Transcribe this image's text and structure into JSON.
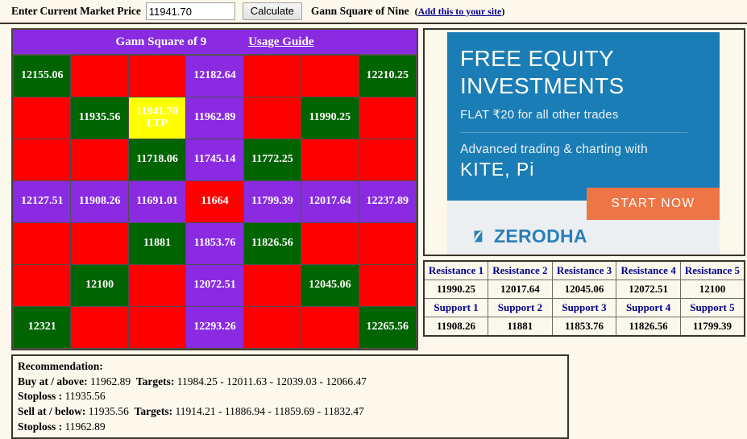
{
  "topbar": {
    "label": "Enter Current Market Price",
    "input_value": "11941.70",
    "input_placeholder": "",
    "calculate_label": "Calculate",
    "title": "Gann Square of Nine",
    "link_open": "(",
    "link_text": "Add this to your site",
    "link_close": ")"
  },
  "gann": {
    "header_title": "Gann Square of 9",
    "header_link": "Usage Guide",
    "colors": {
      "red": "#fe0000",
      "green": "#006400",
      "purple": "#8a2be2",
      "yellow": "#ffff00",
      "ltp_text": "#fe0000"
    },
    "ltp_label": "LTP",
    "rows": [
      [
        {
          "text": "12155.06",
          "color": "green"
        },
        {
          "text": "",
          "color": "red"
        },
        {
          "text": "",
          "color": "red"
        },
        {
          "text": "12182.64",
          "color": "purple"
        },
        {
          "text": "",
          "color": "red"
        },
        {
          "text": "",
          "color": "red"
        },
        {
          "text": "12210.25",
          "color": "green"
        }
      ],
      [
        {
          "text": "",
          "color": "red"
        },
        {
          "text": "11935.56",
          "color": "green"
        },
        {
          "text": "11941.70",
          "color": "yellow",
          "ltp": true
        },
        {
          "text": "11962.89",
          "color": "purple"
        },
        {
          "text": "",
          "color": "red"
        },
        {
          "text": "11990.25",
          "color": "green"
        },
        {
          "text": "",
          "color": "red"
        }
      ],
      [
        {
          "text": "",
          "color": "red"
        },
        {
          "text": "",
          "color": "red"
        },
        {
          "text": "11718.06",
          "color": "green"
        },
        {
          "text": "11745.14",
          "color": "purple"
        },
        {
          "text": "11772.25",
          "color": "green"
        },
        {
          "text": "",
          "color": "red"
        },
        {
          "text": "",
          "color": "red"
        }
      ],
      [
        {
          "text": "12127.51",
          "color": "purple"
        },
        {
          "text": "11908.26",
          "color": "purple"
        },
        {
          "text": "11691.01",
          "color": "purple"
        },
        {
          "text": "11664",
          "color": "red"
        },
        {
          "text": "11799.39",
          "color": "purple"
        },
        {
          "text": "12017.64",
          "color": "purple"
        },
        {
          "text": "12237.89",
          "color": "purple"
        }
      ],
      [
        {
          "text": "",
          "color": "red"
        },
        {
          "text": "",
          "color": "red"
        },
        {
          "text": "11881",
          "color": "green"
        },
        {
          "text": "11853.76",
          "color": "purple"
        },
        {
          "text": "11826.56",
          "color": "green"
        },
        {
          "text": "",
          "color": "red"
        },
        {
          "text": "",
          "color": "red"
        }
      ],
      [
        {
          "text": "",
          "color": "red"
        },
        {
          "text": "12100",
          "color": "green"
        },
        {
          "text": "",
          "color": "red"
        },
        {
          "text": "12072.51",
          "color": "purple"
        },
        {
          "text": "",
          "color": "red"
        },
        {
          "text": "12045.06",
          "color": "green"
        },
        {
          "text": "",
          "color": "red"
        }
      ],
      [
        {
          "text": "12321",
          "color": "green"
        },
        {
          "text": "",
          "color": "red"
        },
        {
          "text": "",
          "color": "red"
        },
        {
          "text": "12293.26",
          "color": "purple"
        },
        {
          "text": "",
          "color": "red"
        },
        {
          "text": "",
          "color": "red"
        },
        {
          "text": "12265.56",
          "color": "green"
        }
      ]
    ]
  },
  "ad": {
    "headline_line1": "FREE EQUITY",
    "headline_line2": "INVESTMENTS",
    "subline": "FLAT ₹20 for all other trades",
    "subline2": "Advanced trading & charting with",
    "products": "KITE, Pi",
    "cta_label": "START NOW",
    "brand": "ZERODHA",
    "brand_color": "#2a7fb8",
    "panel_color": "#1b7db5",
    "cta_color": "#ee7546"
  },
  "sr_table": {
    "resistance_headers": [
      "Resistance 1",
      "Resistance 2",
      "Resistance 3",
      "Resistance 4",
      "Resistance 5"
    ],
    "resistance_values": [
      "11990.25",
      "12017.64",
      "12045.06",
      "12072.51",
      "12100"
    ],
    "support_headers": [
      "Support 1",
      "Support 2",
      "Support 3",
      "Support 4",
      "Support 5"
    ],
    "support_values": [
      "11908.26",
      "11881",
      "11853.76",
      "11826.56",
      "11799.39"
    ]
  },
  "recommendation": {
    "title": "Recommendation:",
    "buy_label": "Buy at / above:",
    "buy_value": "11962.89",
    "buy_targets_label": "Targets:",
    "buy_targets": "11984.25 - 12011.63 - 12039.03 - 12066.47",
    "buy_stoploss_label": "Stoploss :",
    "buy_stoploss": "11935.56",
    "sell_label": "Sell at / below:",
    "sell_value": "11935.56",
    "sell_targets_label": "Targets:",
    "sell_targets": "11914.21 - 11886.94 - 11859.69 - 11832.47",
    "sell_stoploss_label": "Stoploss :",
    "sell_stoploss": "11962.89"
  }
}
